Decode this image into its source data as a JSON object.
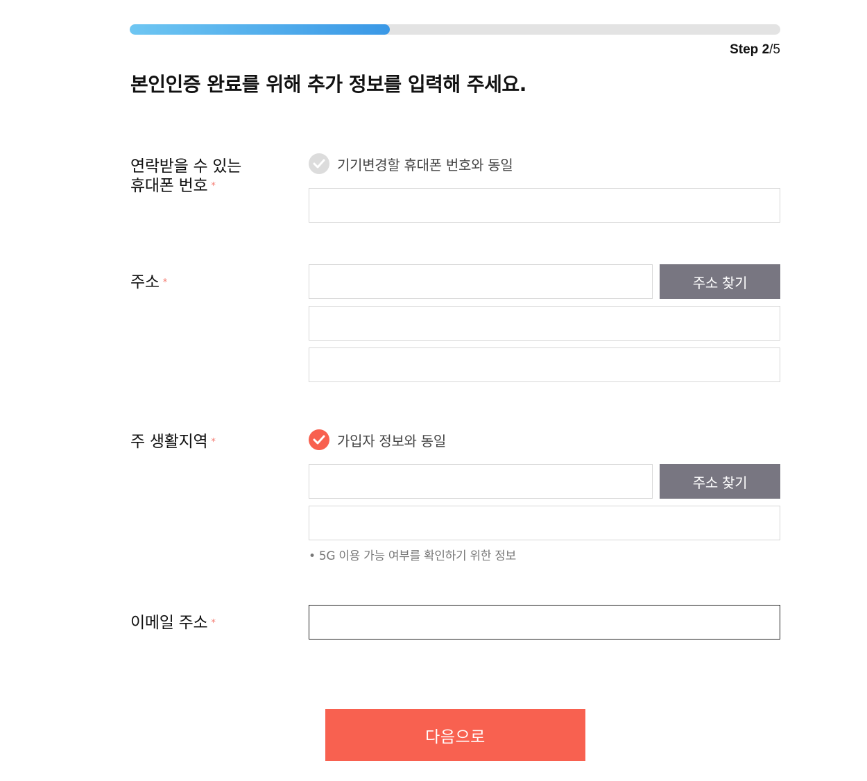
{
  "progress": {
    "fraction": 0.4,
    "step_word": "Step",
    "current_step": "2",
    "total_suffix": "/5"
  },
  "page_title": "본인인증 완료를 위해 추가 정보를 입력해 주세요.",
  "phone": {
    "label_line1": "연락받을 수 있는",
    "label_line2": "휴대폰 번호",
    "required": "*",
    "same_as_label": "기기변경할 휴대폰 번호와 동일",
    "same_as_checked": false,
    "value": ""
  },
  "address": {
    "label": "주소",
    "required": "*",
    "zip_value": "",
    "search_button": "주소 찾기",
    "line1_value": "",
    "line2_value": ""
  },
  "region": {
    "label": "주 생활지역",
    "required": "*",
    "same_as_label": "가입자 정보와 동일",
    "same_as_checked": true,
    "zip_value": "",
    "search_button": "주소 찾기",
    "detail_value": "",
    "note": "• 5G 이용 가능 여부를 확인하기 위한 정보"
  },
  "email": {
    "label": "이메일 주소",
    "required": "*",
    "value": ""
  },
  "next_button": "다음으로",
  "colors": {
    "accent": "#f86150",
    "progress_start": "#6ec6f2",
    "progress_end": "#3a98e6",
    "button_gray": "#787681",
    "required": "#f47c72"
  }
}
